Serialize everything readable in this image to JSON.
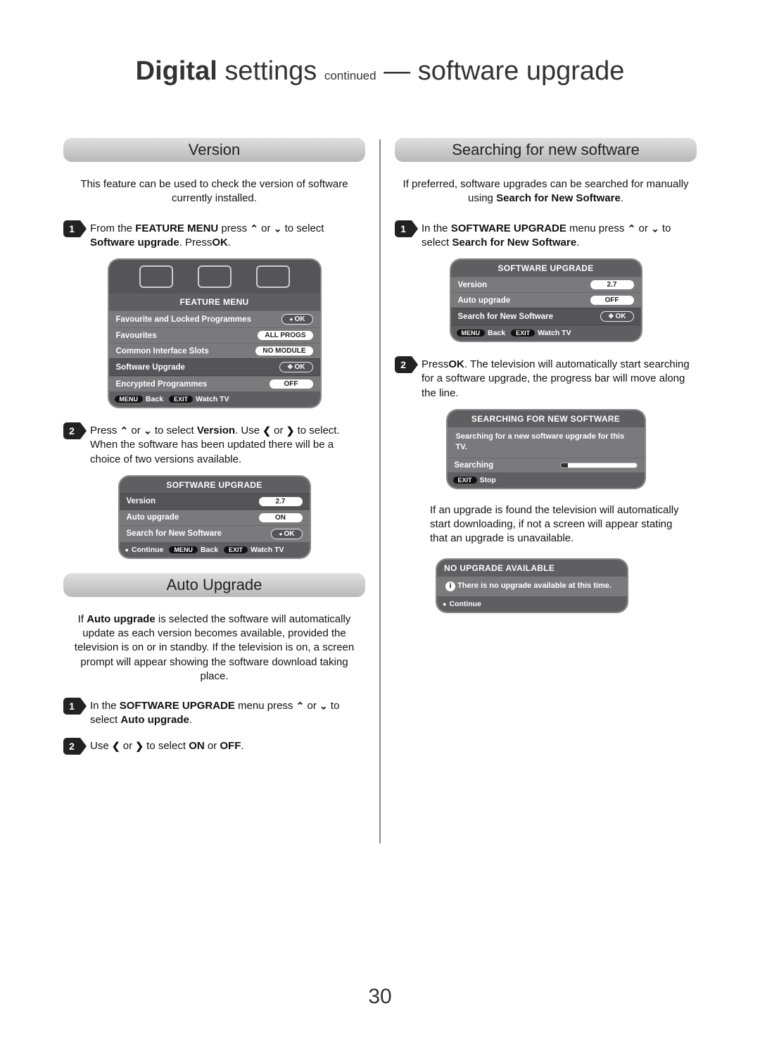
{
  "page": {
    "title_bold": "Digital",
    "title_normal": " settings ",
    "title_small": "continued",
    "title_dash": " — ",
    "title_rest": "software upgrade",
    "number": "30"
  },
  "left": {
    "version": {
      "heading": "Version",
      "intro": "This feature can be used to check the version of software currently installed.",
      "step1_a": "From the ",
      "step1_b": "FEATURE MENU",
      "step1_c": " press ",
      "step1_d": " or ",
      "step1_e": " to select ",
      "step1_f": "Software upgrade",
      "step1_g": ". Press",
      "step1_h": "OK",
      "step1_i": ".",
      "menu1": {
        "title": "FEATURE MENU",
        "rows": [
          {
            "label": "Favourite and Locked Programmes",
            "val": "OK",
            "type": "ok"
          },
          {
            "label": "Favourites",
            "val": "ALL PROGS",
            "type": "pill"
          },
          {
            "label": "Common Interface Slots",
            "val": "NO MODULE",
            "type": "pill"
          },
          {
            "label": "Software Upgrade",
            "val": "OK",
            "type": "okcross",
            "sel": true
          },
          {
            "label": "Encrypted Programmes",
            "val": "OFF",
            "type": "pill"
          }
        ],
        "foot_menu": "MENU",
        "foot_back": "Back",
        "foot_exit": "EXIT",
        "foot_watch": "Watch TV"
      },
      "step2_a": "Press ",
      "step2_b": " or ",
      "step2_c": " to select ",
      "step2_d": "Version",
      "step2_e": ". Use ",
      "step2_f": " or ",
      "step2_g": " to select. When the software has been updated there will be a choice of two versions available.",
      "menu2": {
        "title": "SOFTWARE UPGRADE",
        "rows": [
          {
            "label": "Version",
            "val": "2.7",
            "type": "pill",
            "sel": true
          },
          {
            "label": "Auto upgrade",
            "val": "ON",
            "type": "pill"
          },
          {
            "label": "Search for New Software",
            "val": "OK",
            "type": "ok"
          }
        ],
        "foot_continue": "Continue",
        "foot_menu": "MENU",
        "foot_back": "Back",
        "foot_exit": "EXIT",
        "foot_watch": "Watch TV"
      }
    },
    "auto": {
      "heading": "Auto Upgrade",
      "intro_a": "If ",
      "intro_b": "Auto upgrade",
      "intro_c": " is selected the software will automatically update as each version becomes available, provided the television is on or in standby. If the television is on, a screen prompt will appear showing the software download taking place.",
      "step1_a": "In the ",
      "step1_b": "SOFTWARE UPGRADE",
      "step1_c": " menu press ",
      "step1_d": " or ",
      "step1_e": " to select ",
      "step1_f": "Auto upgrade",
      "step1_g": ".",
      "step2_a": "Use ",
      "step2_b": " or ",
      "step2_c": " to select ",
      "step2_d": "ON",
      "step2_e": " or ",
      "step2_f": "OFF",
      "step2_g": "."
    }
  },
  "right": {
    "search": {
      "heading": "Searching for new software",
      "intro_a": "If preferred, software upgrades can be searched for manually using ",
      "intro_b": "Search for New Software",
      "intro_c": ".",
      "step1_a": "In the ",
      "step1_b": "SOFTWARE UPGRADE",
      "step1_c": " menu press ",
      "step1_d": " or ",
      "step1_e": " to select ",
      "step1_f": "Search for New Software",
      "step1_g": ".",
      "menu1": {
        "title": "SOFTWARE UPGRADE",
        "rows": [
          {
            "label": "Version",
            "val": "2.7",
            "type": "pill"
          },
          {
            "label": "Auto upgrade",
            "val": "OFF",
            "type": "pill"
          },
          {
            "label": "Search for New Software",
            "val": "OK",
            "type": "okcross",
            "sel": true
          }
        ],
        "foot_menu": "MENU",
        "foot_back": "Back",
        "foot_exit": "EXIT",
        "foot_watch": "Watch TV"
      },
      "step2_a": "Press",
      "step2_b": "OK",
      "step2_c": ". The television will automatically start searching for a software upgrade, the progress bar will move along the line.",
      "menu2": {
        "title": "SEARCHING FOR NEW SOFTWARE",
        "msg1": "Searching for a new software upgrade for this TV.",
        "msg2": "Searching",
        "foot_exit": "EXIT",
        "foot_stop": "Stop"
      },
      "after": "If an upgrade is found the television will automatically start downloading, if not a screen will appear stating that an upgrade is unavailable.",
      "menu3": {
        "title": "NO UPGRADE AVAILABLE",
        "msg": "There is no upgrade available at this time.",
        "foot_continue": "Continue"
      }
    }
  },
  "glyphs": {
    "up": "⌃",
    "down": "⌄",
    "left": "❮",
    "right": "❯"
  }
}
